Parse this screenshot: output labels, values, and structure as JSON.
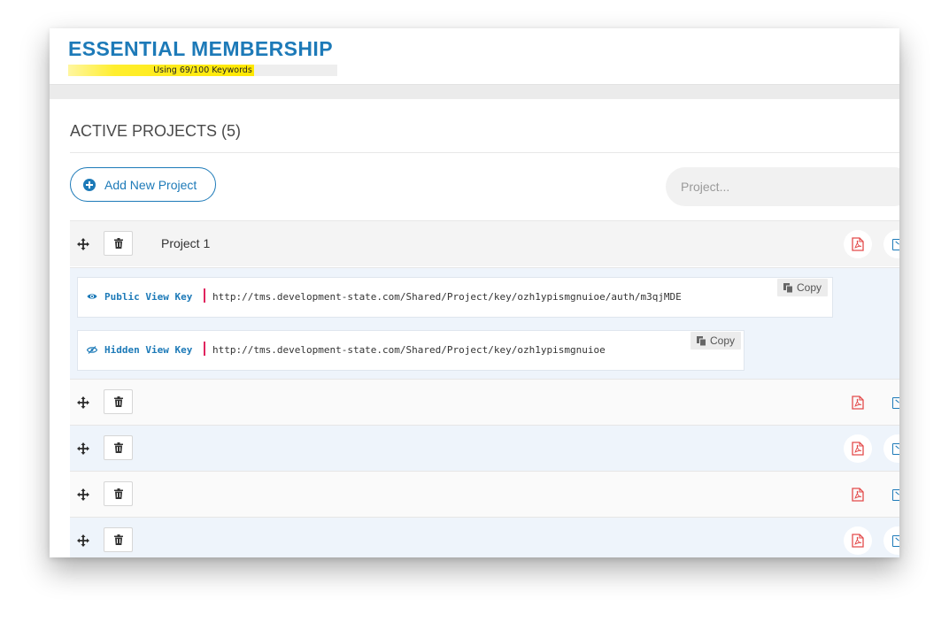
{
  "header": {
    "plan_title": "ESSENTIAL MEMBERSHIP",
    "keyword_usage": "Using 69/100 Keywords",
    "keyword_fraction": 0.69
  },
  "main": {
    "section_title": "ACTIVE PROJECTS (5)",
    "add_button_label": "Add New Project",
    "search_placeholder": "Project..."
  },
  "projects": [
    {
      "name": "Project 1",
      "expanded": true
    },
    {
      "name": "",
      "expanded": false
    },
    {
      "name": "",
      "expanded": false
    },
    {
      "name": "",
      "expanded": false
    },
    {
      "name": "",
      "expanded": false
    }
  ],
  "keys": {
    "public_label": "Public View Key",
    "public_url": "http://tms.development-state.com/Shared/Project/key/ozh1ypismgnuioe/auth/m3qjMDE",
    "hidden_label": "Hidden View Key",
    "hidden_url": "http://tms.development-state.com/Shared/Project/key/ozh1ypismgnuioe",
    "copy_label": "Copy"
  },
  "colors": {
    "accent": "#1d7ab8",
    "pdf": "#e34b4b",
    "separator": "#e0245e",
    "keyword_bar": "#ffe800"
  },
  "icons": {
    "add": "plus-circle-icon",
    "move": "move-arrows-icon",
    "delete": "trash-icon",
    "pdf": "pdf-icon",
    "excel": "excel-icon",
    "public_key": "eye-icon",
    "hidden_key": "eye-slash-icon",
    "copy": "copy-icon"
  }
}
